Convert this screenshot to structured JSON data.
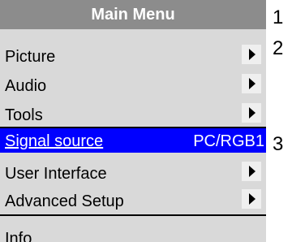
{
  "menu": {
    "title": "Main Menu",
    "items": [
      {
        "label": "Picture",
        "value": ""
      },
      {
        "label": "Audio",
        "value": ""
      },
      {
        "label": "Tools",
        "value": ""
      },
      {
        "label": "Signal source",
        "value": "PC/RGB1"
      },
      {
        "label": "User Interface",
        "value": ""
      },
      {
        "label": "Advanced Setup",
        "value": ""
      },
      {
        "label": "Info",
        "value": ""
      }
    ]
  },
  "callouts": [
    "1",
    "2",
    "3"
  ],
  "colors": {
    "title_bar": "#8c8c8c",
    "menu_background": "#d9d9d9",
    "selected_background": "#0000ff",
    "selected_text": "#ffffff"
  }
}
